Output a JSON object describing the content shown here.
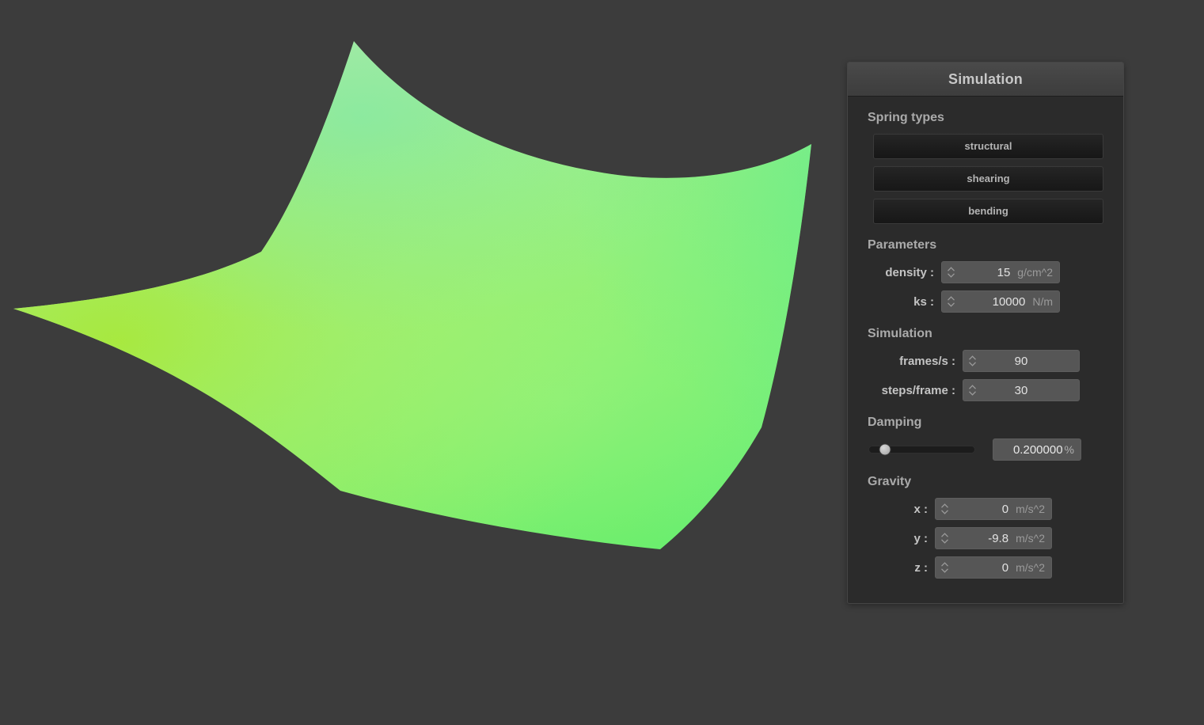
{
  "app": {
    "background_color": "#3c3c3c",
    "panel_color": "#2b2b2b"
  },
  "cloth": {
    "name": "cloth-mesh",
    "colors": {
      "top_peak": "#b9e89b",
      "left_corner": "#9ae63d",
      "right_corner": "#4de894",
      "bottom_corner": "#50e858",
      "center": "#7cec78",
      "upper_mid": "#8ef0a0"
    }
  },
  "panel": {
    "title": "Simulation",
    "spring_types": {
      "header": "Spring types",
      "buttons": [
        {
          "label": "structural"
        },
        {
          "label": "shearing"
        },
        {
          "label": "bending"
        }
      ]
    },
    "parameters": {
      "header": "Parameters",
      "fields": [
        {
          "label": "density :",
          "value": "15",
          "unit": "g/cm^2"
        },
        {
          "label": "ks :",
          "value": "10000",
          "unit": "N/m"
        }
      ]
    },
    "simulation": {
      "header": "Simulation",
      "fields": [
        {
          "label": "frames/s :",
          "value": "90",
          "unit": ""
        },
        {
          "label": "steps/frame :",
          "value": "30",
          "unit": ""
        }
      ]
    },
    "damping": {
      "header": "Damping",
      "slider": {
        "value": 0.2,
        "min": 0,
        "max": 1,
        "handle_percent": 15
      },
      "value": "0.200000",
      "unit": "%"
    },
    "gravity": {
      "header": "Gravity",
      "fields": [
        {
          "label": "x :",
          "value": "0",
          "unit": "m/s^2"
        },
        {
          "label": "y :",
          "value": "-9.8",
          "unit": "m/s^2"
        },
        {
          "label": "z :",
          "value": "0",
          "unit": "m/s^2"
        }
      ]
    }
  }
}
